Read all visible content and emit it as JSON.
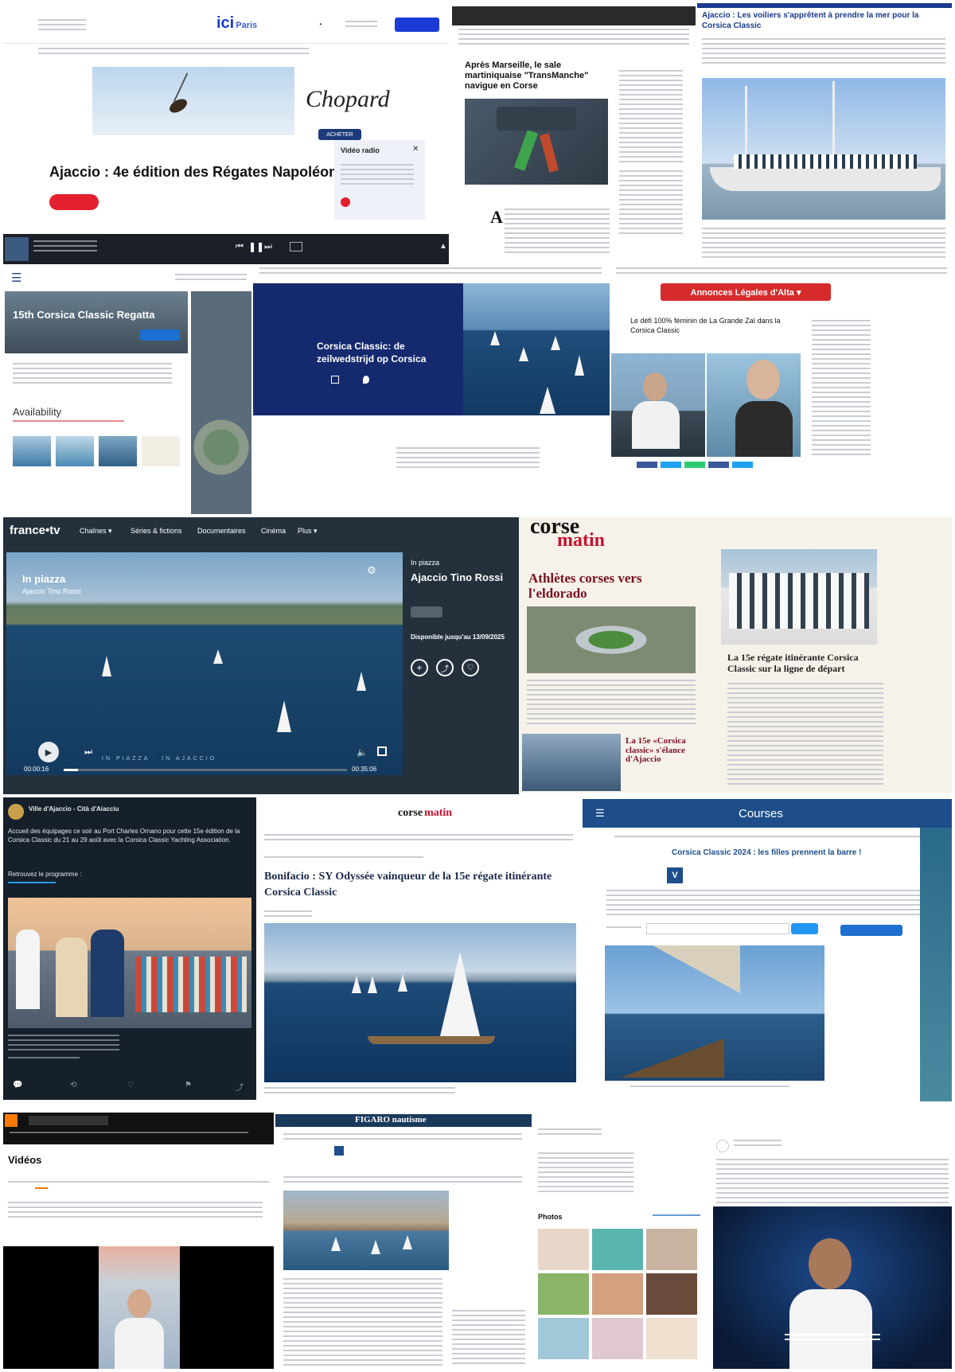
{
  "colors": {
    "icibleu": "#1a3bd6",
    "ftv_dark": "#24313d",
    "corsematin_red": "#c8102e",
    "navy": "#152a6e",
    "x_dark": "#15202b",
    "courses_blue": "#1d4e89",
    "figaro_blue": "#1a3a5c",
    "orange": "#ff7900",
    "annonces_red": "#d62b2b"
  },
  "ici": {
    "logo": "ici",
    "logo_suffix": "Paris",
    "ad_brand": "Chopard",
    "ad_cta": "ACHETER",
    "headline": "Ajaccio : 4e édition des Régates Napoléon",
    "video_panel_title": "Vidéo radio",
    "close_glyph": "✕"
  },
  "player_bar": {
    "play_glyph": "▶",
    "pause_glyph": "❚❚",
    "next_glyph": "⏭"
  },
  "marseille": {
    "headline": "Après Marseille, le sale martiniquaise \"TransManche\" navigue en Corse",
    "drop_cap": "A"
  },
  "voile": {
    "headline": "Ajaccio : Les voiliers s'apprêtent à prendre la mer pour la Corsica Classic"
  },
  "regatta": {
    "menu_glyph": "☰",
    "banner_title": "15th Corsica Classic Regatta",
    "section": "Availability"
  },
  "zeil": {
    "title": "Corsica Classic: de zeilwedstrijd op Corsica"
  },
  "annonces": {
    "title": "Annonces Légales d'Alta ▾",
    "headline": "Le défi 100% féminin de La Grande Zaï dans la Corsica Classic"
  },
  "francetv": {
    "logo": "france•tv",
    "nav": [
      "Chaînes ▾",
      "Séries & fictions",
      "Documentaires",
      "Cinéma",
      "Plus ▾"
    ],
    "overlay_1": "In piazza",
    "overlay_2": "Ajaccio Tino Rossi",
    "side_title": "In piazza",
    "side_subtitle": "Ajaccio Tino Rossi",
    "availability": "Disponible jusqu'au 13/09/2025",
    "time_start": "00:00:16",
    "time_end": "00:35:06",
    "progress": 0.05,
    "ticker": "IN PIAZZA · IN AJACCIO"
  },
  "corsematin_print": {
    "logo_1": "corse",
    "logo_2": "matin",
    "headline": "Athlètes corses vers l'eldorado",
    "bottom_headline": "La 15e «Corsica classic» s'élance d'Ajaccio",
    "right_headline": "La 15e régate itinérante Corsica Classic sur la ligne de départ"
  },
  "tweet": {
    "author": "Ville d'Ajaccio - Cità d'Aiacciu",
    "body": "Accueil des équipages ce soir au Port Charles Ornano pour cette 15e édition de la Corsica Classic du 21 au 29 août avec la Corsica Classic Yachting Association.",
    "link_intro": "Retrouvez le programme :"
  },
  "bonifacio": {
    "logo_1": "corse",
    "logo_2": "matin",
    "headline": "Bonifacio : SY Odyssée vainqueur de la 15e régate itinérante Corsica Classic"
  },
  "courses": {
    "title": "Courses",
    "headline": "Corsica Classic 2024 : les filles prennent la barre !",
    "logo_letter": "V"
  },
  "videos": {
    "title": "Vidéos"
  },
  "figaro": {
    "title": "FIGARO nautisme"
  },
  "photos_panel": {
    "title": "Photos"
  }
}
